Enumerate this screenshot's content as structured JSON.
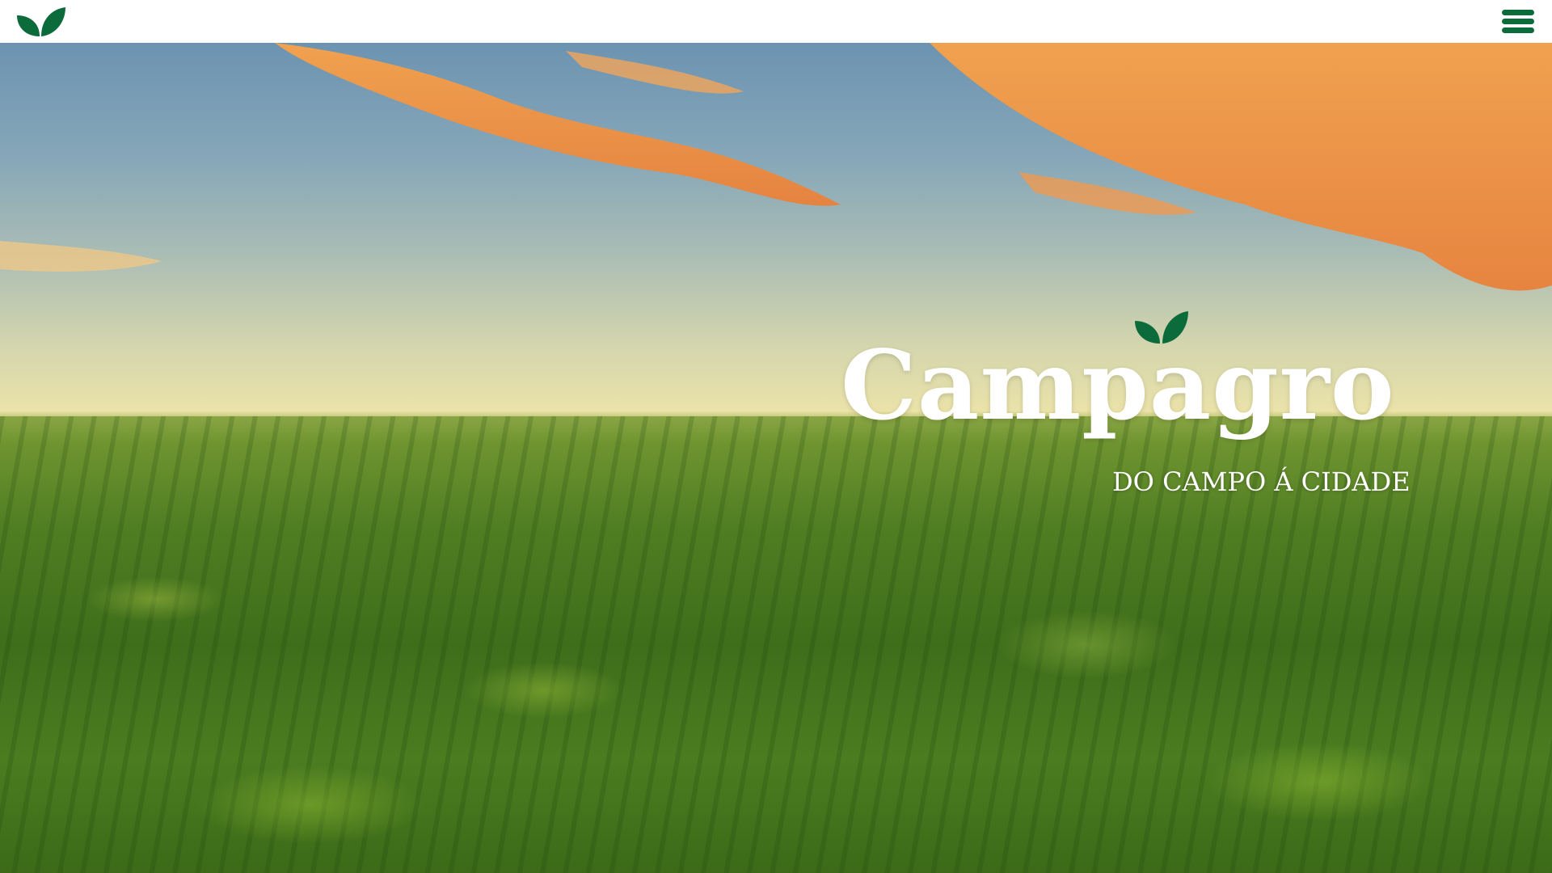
{
  "brand": {
    "name": "Campagro",
    "tagline": "DO CAMPO Á CIDADE",
    "logo_icon": "leaf-icon"
  },
  "header": {
    "logo_icon": "leaf-icon",
    "menu_icon": "hamburger-menu-icon"
  },
  "colors": {
    "brand": "#0b6b3a",
    "header_bg": "#ffffff",
    "title_text": "#ffffff"
  }
}
